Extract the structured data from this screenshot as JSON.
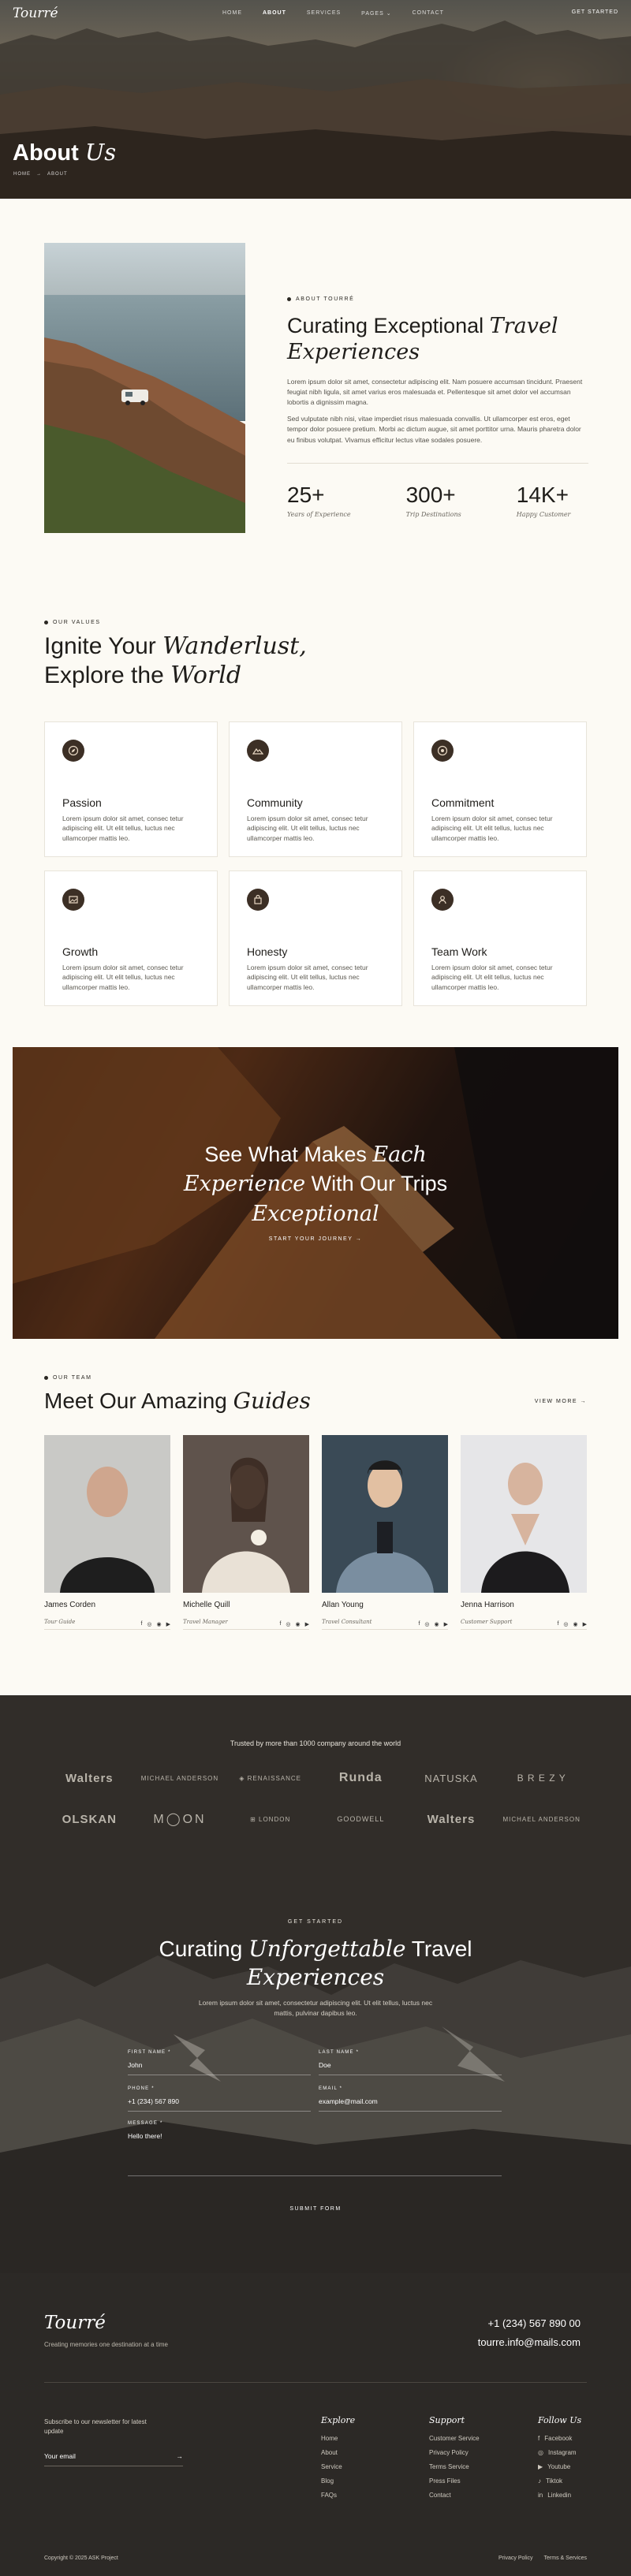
{
  "nav": {
    "logo": "Tourré",
    "items": [
      "HOME",
      "ABOUT",
      "SERVICES",
      "PAGES ⌄",
      "CONTACT"
    ],
    "active": "ABOUT",
    "cta": "GET STARTED"
  },
  "hero": {
    "title_plain": "About",
    "title_italic": "Us",
    "crumb_home": "HOME",
    "crumb_sep": "→",
    "crumb_current": "ABOUT"
  },
  "about": {
    "eyebrow": "ABOUT TOURRÉ",
    "title_plain": "Curating Exceptional",
    "title_italic_1": "Travel",
    "title_italic_2": "Experiences",
    "p1": "Lorem ipsum dolor sit amet, consectetur adipiscing elit. Nam posuere accumsan tincidunt. Praesent feugiat nibh ligula, sit amet varius eros malesuada et. Pellentesque sit amet dolor vel accumsan lobortis a dignissim magna.",
    "p2": "Sed vulputate nibh nisi, vitae imperdiet risus malesuada convallis. Ut ullamcorper est eros, eget tempor dolor posuere pretium. Morbi ac dictum augue, sit amet porttitor urna. Mauris pharetra dolor eu finibus volutpat. Vivamus efficitur lectus vitae sodales posuere.",
    "stats": [
      {
        "num": "25+",
        "label": "Years of Experience"
      },
      {
        "num": "300+",
        "label": "Trip Destinations"
      },
      {
        "num": "14K+",
        "label": "Happy Customer"
      }
    ]
  },
  "values": {
    "eyebrow": "OUR VALUES",
    "title_line1_plain": "Ignite Your",
    "title_line1_italic": "Wanderlust,",
    "title_line2_plain": "Explore the",
    "title_line2_italic": "World",
    "cards": [
      {
        "icon": "compass-icon",
        "title": "Passion",
        "text": "Lorem ipsum dolor sit amet, consec tetur adipiscing elit. Ut elit tellus, luctus nec ullamcorper mattis leo."
      },
      {
        "icon": "mountain-icon",
        "title": "Community",
        "text": "Lorem ipsum dolor sit amet, consec tetur adipiscing elit. Ut elit tellus, luctus nec ullamcorper mattis leo."
      },
      {
        "icon": "target-icon",
        "title": "Commitment",
        "text": "Lorem ipsum dolor sit amet, consec tetur adipiscing elit. Ut elit tellus, luctus nec ullamcorper mattis leo."
      },
      {
        "icon": "image-icon",
        "title": "Growth",
        "text": "Lorem ipsum dolor sit amet, consec tetur adipiscing elit. Ut elit tellus, luctus nec ullamcorper mattis leo."
      },
      {
        "icon": "bag-icon",
        "title": "Honesty",
        "text": "Lorem ipsum dolor sit amet, consec tetur adipiscing elit. Ut elit tellus, luctus nec ullamcorper mattis leo."
      },
      {
        "icon": "person-icon",
        "title": "Team Work",
        "text": "Lorem ipsum dolor sit amet, consec tetur adipiscing elit. Ut elit tellus, luctus nec ullamcorper mattis leo."
      }
    ]
  },
  "banner": {
    "l1_plain": "See What Makes",
    "l1_italic": "Each",
    "l2_italic": "Experience",
    "l2_plain": "With Our Trips",
    "l3_italic": "Exceptional",
    "cta": "START YOUR JOURNEY →"
  },
  "team": {
    "eyebrow": "OUR TEAM",
    "title_plain": "Meet Our Amazing",
    "title_italic": "Guides",
    "view_more": "VIEW MORE →",
    "members": [
      {
        "name": "James Corden",
        "role": "Tour Guide"
      },
      {
        "name": "Michelle Quill",
        "role": "Travel Manager"
      },
      {
        "name": "Allan Young",
        "role": "Travel Consultant"
      },
      {
        "name": "Jenna Harrison",
        "role": "Customer Support"
      }
    ],
    "social_glyphs": [
      "f",
      "◎",
      "◉",
      "▶"
    ]
  },
  "trusted": {
    "text": "Trusted by more than 1000 company around the world",
    "logos": [
      "Walters",
      "MICHAEL ANDERSON",
      "◈ RENAISSANCE",
      "Runda",
      "NATUSKA",
      "B R E Z Y",
      "OLSKAN",
      "M◯ON",
      "⊞ LONDON",
      "GOODWELL",
      "Walters",
      "MICHAEL ANDERSON"
    ]
  },
  "contact": {
    "eyebrow": "GET STARTED",
    "title_l1_plain": "Curating",
    "title_l1_italic": "Unforgettable",
    "title_l1_plain2": "Travel",
    "title_l2_italic": "Experiences",
    "subtitle": "Lorem ipsum dolor sit amet, consectetur adipiscing elit. Ut elit tellus, luctus nec mattis, pulvinar dapibus leo.",
    "fields": [
      {
        "label": "FIRST NAME *",
        "value": "John"
      },
      {
        "label": "LAST NAME *",
        "value": "Doe"
      },
      {
        "label": "PHONE *",
        "value": "+1 (234) 567 890"
      },
      {
        "label": "EMAIL *",
        "value": "example@mail.com"
      },
      {
        "label": "MESSAGE *",
        "value": "Hello there!"
      }
    ],
    "submit": "SUBMIT FORM"
  },
  "footer": {
    "logo": "Tourré",
    "tagline": "Creating memories one destination at a time",
    "phone": "+1 (234) 567 890 00",
    "email": "tourre.info@mails.com",
    "newsletter_text": "Subscribe to our newsletter for latest update",
    "newsletter_placeholder": "Your email",
    "newsletter_arrow": "→",
    "explore_title": "Explore",
    "explore": [
      "Home",
      "About",
      "Service",
      "Blog",
      "FAQs"
    ],
    "support_title": "Support",
    "support": [
      "Customer Service",
      "Privacy Policy",
      "Terms Service",
      "Press Files",
      "Contact"
    ],
    "follow_title": "Follow Us",
    "follow": [
      {
        "icon": "facebook-icon",
        "glyph": "f",
        "label": "Facebook"
      },
      {
        "icon": "instagram-icon",
        "glyph": "◎",
        "label": "Instagram"
      },
      {
        "icon": "youtube-icon",
        "glyph": "▶",
        "label": "Youtube"
      },
      {
        "icon": "tiktok-icon",
        "glyph": "♪",
        "label": "Tiktok"
      },
      {
        "icon": "linkedin-icon",
        "glyph": "in",
        "label": "Linkedin"
      }
    ],
    "copyright": "Copyright © 2025 ASK Project",
    "legal": [
      "Privacy Policy",
      "Terms & Services"
    ]
  }
}
